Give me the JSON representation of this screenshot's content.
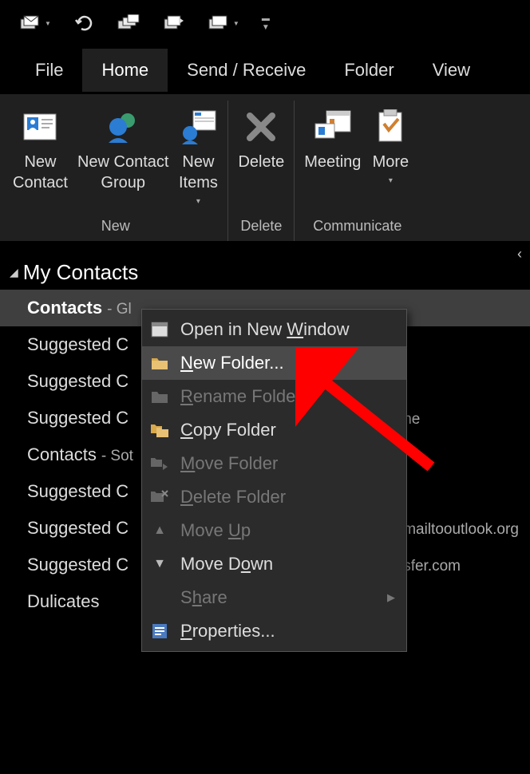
{
  "qat": {
    "items": [
      "send-receive",
      "undo",
      "all-folders",
      "send-all",
      "folder-dropdown",
      "customize"
    ]
  },
  "tabs": {
    "file": "File",
    "home": "Home",
    "sendreceive": "Send / Receive",
    "folder": "Folder",
    "view": "View",
    "active": "home"
  },
  "ribbon": {
    "groups": {
      "new": {
        "label": "New",
        "buttons": {
          "new_contact": "New\nContact",
          "new_contact_group": "New Contact\nGroup",
          "new_items": "New\nItems"
        }
      },
      "delete": {
        "label": "Delete",
        "buttons": {
          "delete": "Delete"
        }
      },
      "communicate": {
        "label": "Communicate",
        "buttons": {
          "meeting": "Meeting",
          "more": "More"
        }
      }
    }
  },
  "nav": {
    "header": "My Contacts",
    "items": [
      {
        "primary": "Contacts",
        "suffix": "- Gl"
      },
      {
        "primary": "Suggested C",
        "suffix": ""
      },
      {
        "primary": "Suggested C",
        "suffix": ""
      },
      {
        "primary": "Suggested C",
        "suffix": "ne"
      },
      {
        "primary": "Contacts",
        "suffix": "- Sot"
      },
      {
        "primary": "Suggested C",
        "suffix": ""
      },
      {
        "primary": "Suggested C",
        "suffix": "mailtooutlook.org"
      },
      {
        "primary": "Suggested C",
        "suffix": "sfer.com"
      },
      {
        "primary": "Dulicates",
        "suffix": ""
      }
    ]
  },
  "context_menu": {
    "open_new_window": {
      "pre": "Open in New ",
      "u": "W",
      "post": "indow"
    },
    "new_folder": {
      "pre": "",
      "u": "N",
      "post": "ew Folder..."
    },
    "rename_folder": {
      "pre": "",
      "u": "R",
      "post": "ename Folder"
    },
    "copy_folder": {
      "pre": "",
      "u": "C",
      "post": "opy Folder"
    },
    "move_folder": {
      "pre": "",
      "u": "M",
      "post": "ove Folder"
    },
    "delete_folder": {
      "pre": "",
      "u": "D",
      "post": "elete Folder"
    },
    "move_up": {
      "pre": "Move ",
      "u": "U",
      "post": "p"
    },
    "move_down": {
      "pre": "Move D",
      "u": "o",
      "post": "wn"
    },
    "share": {
      "pre": "S",
      "u": "h",
      "post": "are"
    },
    "properties": {
      "pre": "",
      "u": "P",
      "post": "roperties..."
    }
  }
}
